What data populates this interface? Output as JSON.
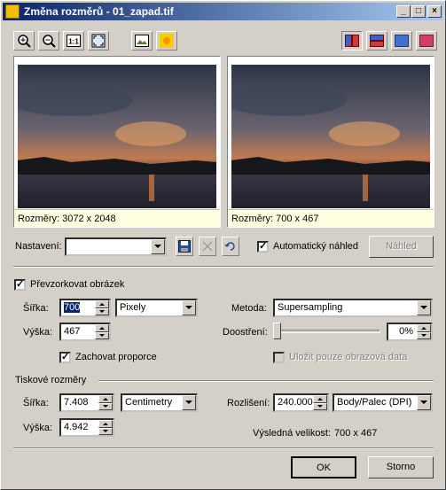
{
  "window": {
    "title": "Změna rozměrů - 01_zapad.tif"
  },
  "previews": {
    "original_caption": "Rozměry: 3072 x 2048",
    "result_caption": "Rozměry: 700 x 467"
  },
  "preset": {
    "label": "Nastavení:",
    "value": "",
    "auto_preview_label": "Automatický náhled",
    "auto_preview_checked": true,
    "preview_button": "Náhled"
  },
  "resample": {
    "checkbox_label": "Převzorkovat obrázek",
    "checked": true,
    "width_label": "Šířka:",
    "width_value": "700",
    "height_label": "Výška:",
    "height_value": "467",
    "unit": "Pixely",
    "method_label": "Metoda:",
    "method_value": "Supersampling",
    "sharpen_label": "Doostření:",
    "sharpen_value": "0%",
    "keep_ratio_label": "Zachovat proporce",
    "keep_ratio_checked": true,
    "save_data_label": "Uložit pouze obrazová data"
  },
  "print": {
    "section_label": "Tiskové rozměry",
    "width_label": "Šířka:",
    "width_value": "7.408",
    "height_label": "Výška:",
    "height_value": "4.942",
    "unit": "Centimetry",
    "resolution_label": "Rozlišení:",
    "resolution_value": "240.000",
    "resolution_unit": "Body/Palec (DPI)",
    "result_size_label": "Výsledná velikost:",
    "result_size_value": "700 x 467"
  },
  "buttons": {
    "ok": "OK",
    "cancel": "Storno"
  }
}
